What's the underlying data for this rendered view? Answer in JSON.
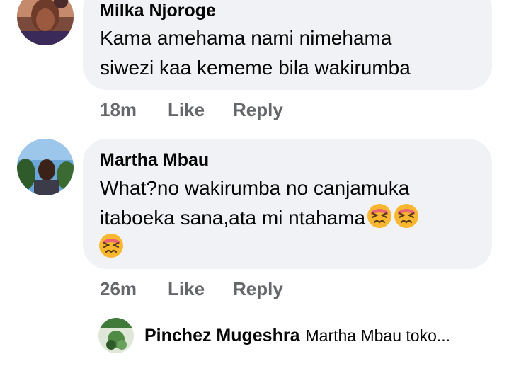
{
  "comments": [
    {
      "author": "Milka Njoroge",
      "lines": [
        "Kama amehama nami nimehama",
        "siwezi kaa kememe bila wakirumba"
      ],
      "time": "18m",
      "like_label": "Like",
      "reply_label": "Reply"
    },
    {
      "author": "Martha Mbau",
      "lines": [
        "What?no wakirumba no canjamuka",
        "itaboeka sana,ata mi ntahama"
      ],
      "emoji": [
        "tired-face-emoji",
        "tired-face-emoji",
        "tired-face-emoji"
      ],
      "time": "26m",
      "like_label": "Like",
      "reply_label": "Reply"
    }
  ],
  "reply": {
    "author": "Pinchez Mugeshra",
    "preview": "Martha Mbau toko..."
  },
  "colors": {
    "bubble": "#f0f2f5",
    "meta": "#65676b",
    "text": "#050505",
    "emoji_face": "#f7b731",
    "emoji_blush": "#e8567c"
  }
}
